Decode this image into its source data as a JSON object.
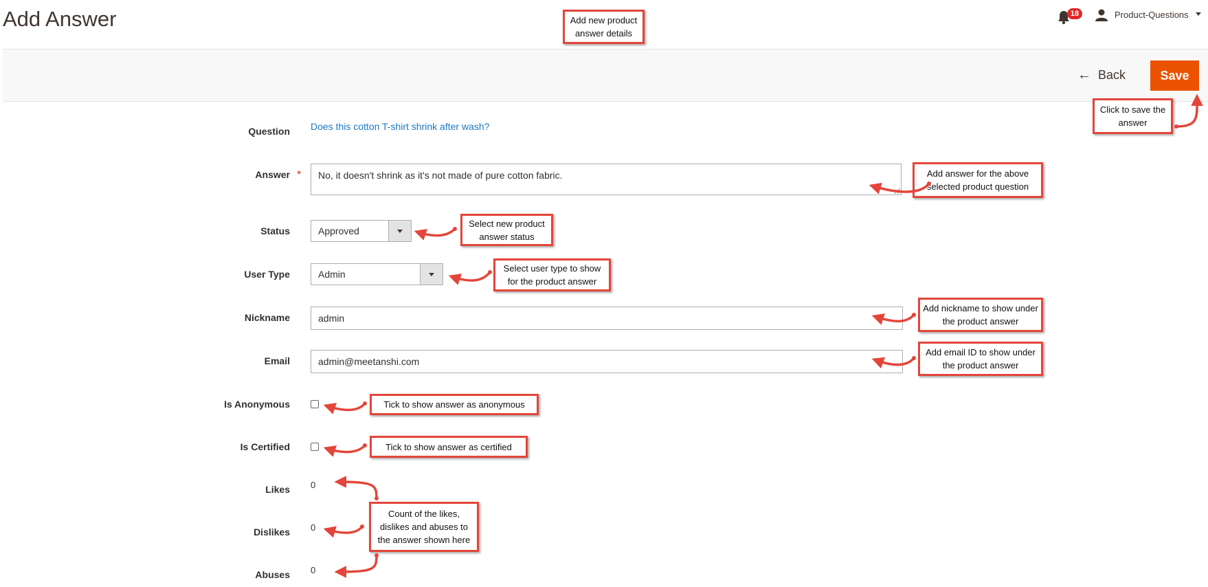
{
  "header": {
    "title": "Add Answer",
    "notifications_count": "18",
    "user_name": "Product-Questions"
  },
  "actions": {
    "back_label": "Back",
    "save_label": "Save"
  },
  "form": {
    "question_label": "Question",
    "question_value": "Does this cotton T-shirt shrink after wash?",
    "answer_label": "Answer",
    "answer_value": "No, it doesn't shrink as it's not made of pure cotton fabric.",
    "required_mark": "*",
    "status_label": "Status",
    "status_value": "Approved",
    "user_type_label": "User Type",
    "user_type_value": "Admin",
    "nickname_label": "Nickname",
    "nickname_value": "admin",
    "email_label": "Email",
    "email_value": "admin@meetanshi.com",
    "anonymous_label": "Is Anonymous",
    "certified_label": "Is Certified",
    "likes_label": "Likes",
    "likes_value": "0",
    "dislikes_label": "Dislikes",
    "dislikes_value": "0",
    "abuses_label": "Abuses",
    "abuses_value": "0"
  },
  "callouts": {
    "details": "Add new product answer details",
    "save": "Click to save the answer",
    "answer": "Add answer for the above selected product question",
    "status": "Select new product answer status",
    "user_type": "Select user type to show for the product answer",
    "nickname": "Add nickname to show under the product answer",
    "email": "Add email ID to show under the product answer",
    "anonymous": "Tick to show answer as anonymous",
    "certified": "Tick to show answer as certified",
    "counts": "Count of the likes, dislikes and abuses to the answer shown here"
  },
  "colors": {
    "accent": "#eb5202",
    "link": "#1979c3",
    "callout_border": "#e4453a",
    "badge": "#e22626"
  }
}
